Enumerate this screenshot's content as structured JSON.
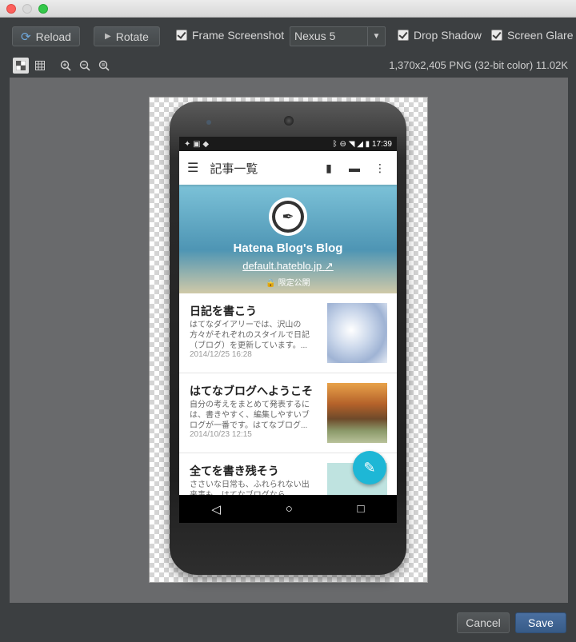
{
  "window": {
    "traffic_lights": [
      "close",
      "minimize",
      "maximize"
    ]
  },
  "toolbar": {
    "reload_label": "Reload",
    "rotate_label": "Rotate",
    "frame_screenshot_label": "Frame Screenshot",
    "device_select_value": "Nexus 5",
    "drop_shadow_label": "Drop Shadow",
    "screen_glare_label": "Screen Glare"
  },
  "subtoolbar": {
    "image_info": "1,370x2,405 PNG (32-bit color) 11.02K"
  },
  "phone_screen": {
    "status_time": "17:39",
    "app_title": "記事一覧",
    "blog_title": "Hatena Blog's Blog",
    "blog_url": "default.hateblo.jp",
    "visibility": "限定公開",
    "entries": [
      {
        "title": "日記を書こう",
        "summary": "はてなダイアリーでは、沢山の方々がそれぞれのスタイルで日記（ブログ）を更新しています。...",
        "date": "2014/12/25 16:28"
      },
      {
        "title": "はてなブログへようこそ",
        "summary": "自分の考えをまとめて発表するには、書きやすく、編集しやすいブログが一番です。はてなブログ...",
        "date": "2014/10/23 12:15"
      },
      {
        "title": "全てを書き残そう",
        "summary": "ささいな日常も、ふれられない出来事も、はてなブログなら...",
        "date": ""
      }
    ]
  },
  "footer": {
    "cancel_label": "Cancel",
    "save_label": "Save"
  },
  "colors": {
    "accent": "#1eb7d6",
    "save_button": "#375b87"
  }
}
